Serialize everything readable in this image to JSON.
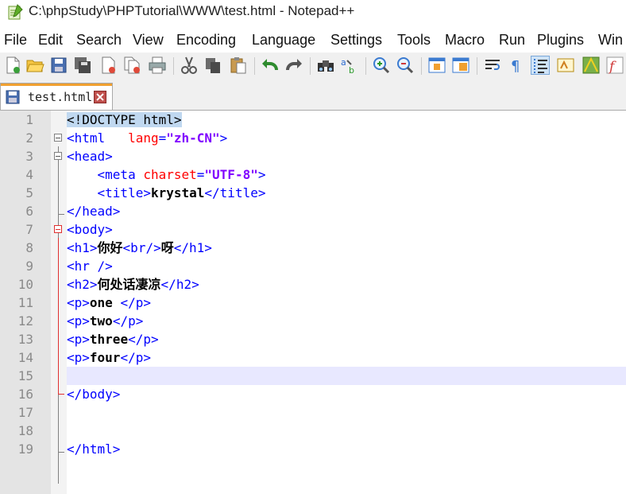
{
  "window": {
    "title": "C:\\phpStudy\\PHPTutorial\\WWW\\test.html - Notepad++"
  },
  "menu": [
    "File",
    "Edit",
    "Search",
    "View",
    "Encoding",
    "Language",
    "Settings",
    "Tools",
    "Macro",
    "Run",
    "Plugins",
    "Win"
  ],
  "toolbar": {
    "icons": [
      "new-file-icon",
      "open-file-icon",
      "save-icon",
      "save-all-icon",
      "close-icon",
      "close-all-icon",
      "print-icon",
      "cut-icon",
      "copy-icon",
      "paste-icon",
      "undo-icon",
      "redo-icon",
      "find-icon",
      "replace-icon",
      "zoom-in-icon",
      "zoom-out-icon",
      "sync-vertical-icon",
      "sync-horizontal-icon",
      "word-wrap-icon",
      "show-all-characters-icon",
      "indent-guide-icon",
      "user-defined-language-icon",
      "document-map-icon",
      "function-list-icon"
    ],
    "active": "indent-guide-icon"
  },
  "tab": {
    "label": "test.html"
  },
  "editor": {
    "current_line": 15,
    "lines": [
      {
        "n": "1",
        "tokens": [
          [
            "hl",
            "<"
          ],
          [
            "hl",
            "!DOCTYPE html"
          ],
          [
            "hl",
            ">"
          ]
        ]
      },
      {
        "n": "2",
        "tokens": [
          [
            "tag",
            "<html   "
          ],
          [
            "attr",
            "lang"
          ],
          [
            "tag",
            "="
          ],
          [
            "val",
            "\"zh-CN\""
          ],
          [
            "tag",
            ">"
          ]
        ]
      },
      {
        "n": "3",
        "tokens": [
          [
            "tag",
            "<head>"
          ]
        ]
      },
      {
        "n": "4",
        "tokens": [
          [
            "tag",
            "    <meta "
          ],
          [
            "attr",
            "charset"
          ],
          [
            "tag",
            "="
          ],
          [
            "val",
            "\"UTF-8\""
          ],
          [
            "tag",
            ">"
          ]
        ]
      },
      {
        "n": "5",
        "tokens": [
          [
            "tag",
            "    <title>"
          ],
          [
            "txt",
            "krystal"
          ],
          [
            "tag",
            "</title>"
          ]
        ]
      },
      {
        "n": "6",
        "tokens": [
          [
            "tag",
            "</head>"
          ]
        ]
      },
      {
        "n": "7",
        "tokens": [
          [
            "tag",
            "<body>"
          ]
        ]
      },
      {
        "n": "8",
        "tokens": [
          [
            "tag",
            "<h1>"
          ],
          [
            "cjk",
            "你好"
          ],
          [
            "tag",
            "<br/>"
          ],
          [
            "cjk",
            "呀"
          ],
          [
            "tag",
            "</h1>"
          ]
        ]
      },
      {
        "n": "9",
        "tokens": [
          [
            "tag",
            "<hr />"
          ]
        ]
      },
      {
        "n": "10",
        "tokens": [
          [
            "tag",
            "<h2>"
          ],
          [
            "cjk",
            "何处话凄凉"
          ],
          [
            "tag",
            "</h2>"
          ]
        ]
      },
      {
        "n": "11",
        "tokens": [
          [
            "tag",
            "<p>"
          ],
          [
            "txt",
            "one "
          ],
          [
            "tag",
            "</p>"
          ]
        ]
      },
      {
        "n": "12",
        "tokens": [
          [
            "tag",
            "<p>"
          ],
          [
            "txt",
            "two"
          ],
          [
            "tag",
            "</p>"
          ]
        ]
      },
      {
        "n": "13",
        "tokens": [
          [
            "tag",
            "<p>"
          ],
          [
            "txt",
            "three"
          ],
          [
            "tag",
            "</p>"
          ]
        ]
      },
      {
        "n": "14",
        "tokens": [
          [
            "tag",
            "<p>"
          ],
          [
            "txt",
            "four"
          ],
          [
            "tag",
            "</p>"
          ]
        ]
      },
      {
        "n": "15",
        "tokens": []
      },
      {
        "n": "16",
        "tokens": [
          [
            "tag",
            "</body>"
          ]
        ]
      },
      {
        "n": "17",
        "tokens": []
      },
      {
        "n": "18",
        "tokens": []
      },
      {
        "n": "19",
        "tokens": [
          [
            "tag",
            "</html>"
          ]
        ]
      }
    ]
  },
  "colors": {
    "tag": "#0000ff",
    "attr": "#ff0000",
    "value": "#8000ff",
    "current_line": "#e8e8ff",
    "tab_accent": "#f0a030"
  }
}
